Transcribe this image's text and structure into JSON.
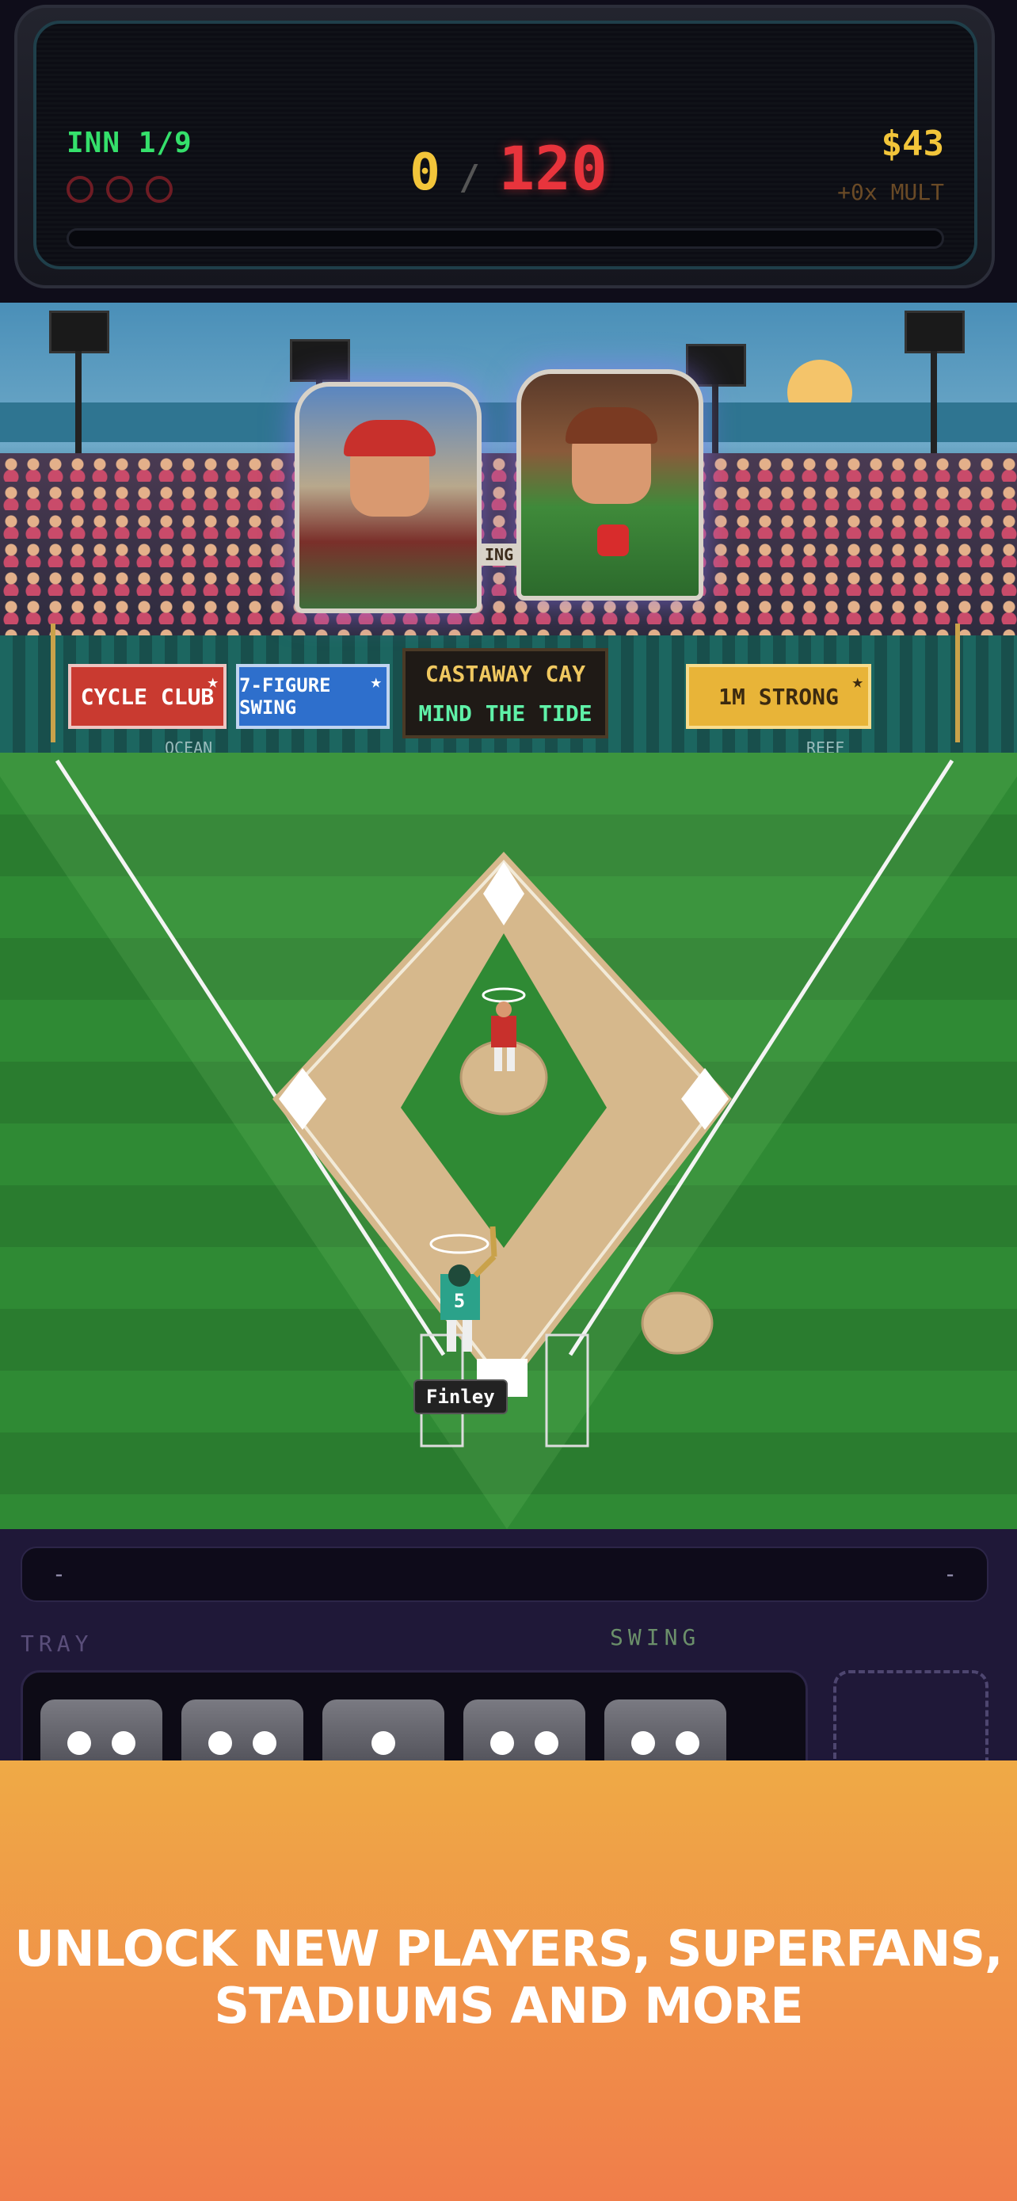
{
  "scoreboard": {
    "inning": "INN 1/9",
    "outs": 3,
    "score_current": "0",
    "score_separator": "/",
    "score_target": "120",
    "money": "$43",
    "multiplier": "+0x MULT",
    "progress_fraction": 0
  },
  "stadium": {
    "cards": [
      {
        "name": "batter-card",
        "icon": "bearded-player-portrait"
      },
      {
        "name": "scout-card",
        "icon": "magnifying-glass-dice-portrait"
      }
    ],
    "banners": {
      "left_red": "CYCLE CLUB",
      "left_blue": "7-FIGURE SWING",
      "right_gold": "1M STRONG",
      "left_sublabel": "OCEAN",
      "right_sublabel": "REEF",
      "card_fragment": "ING"
    },
    "board": {
      "line1": "CASTAWAY CAY",
      "line2": "MIND THE TIDE"
    }
  },
  "field": {
    "batter_name": "Finley",
    "batter_number": "5"
  },
  "controls": {
    "message_left": "-",
    "message_right": "-",
    "tray_label": "TRAY",
    "swing_label": "SWING",
    "dice": [
      2,
      2,
      1,
      2,
      2
    ]
  },
  "promo": {
    "line1": "UNLOCK NEW PLAYERS, SUPERFANS,",
    "line2": "STADIUMS AND MORE"
  },
  "colors": {
    "inning_green": "#35e06b",
    "score_gold": "#f2c53a",
    "target_red": "#e8343c",
    "promo_top": "#efaa46",
    "promo_bottom": "#f07d4a"
  }
}
